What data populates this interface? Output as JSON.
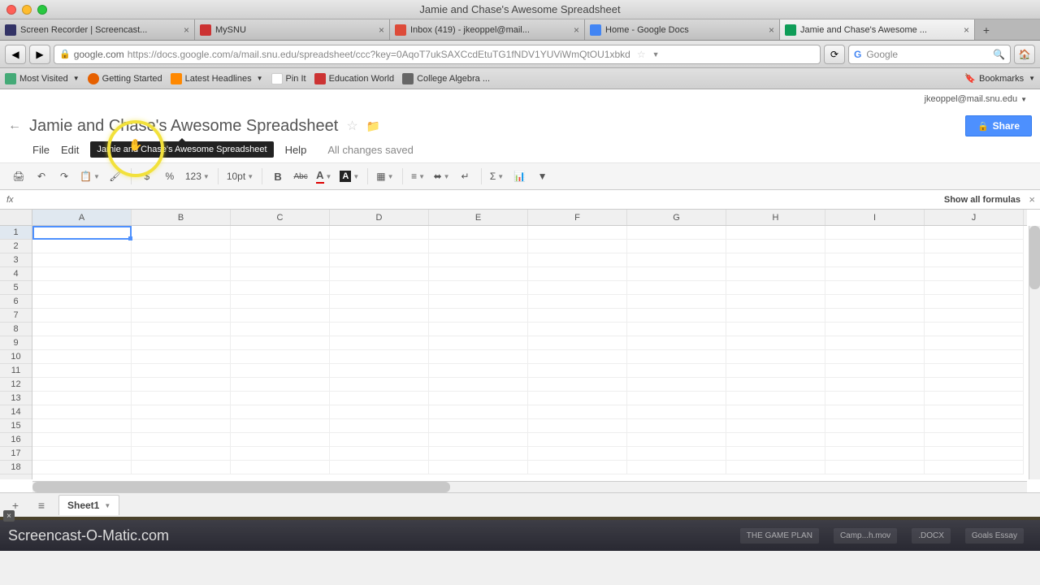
{
  "window": {
    "title": "Jamie and Chase's Awesome Spreadsheet"
  },
  "tabs": [
    {
      "label": "Screen Recorder | Screencast..."
    },
    {
      "label": "MySNU"
    },
    {
      "label": "Inbox (419) - jkeoppel@mail..."
    },
    {
      "label": "Home - Google Docs"
    },
    {
      "label": "Jamie and Chase's Awesome ..."
    }
  ],
  "url": {
    "domain": "google.com",
    "path": "https://docs.google.com/a/mail.snu.edu/spreadsheet/ccc?key=0AqoT7ukSAXCcdEtuTG1fNDV1YUViWmQtOU1xbkd"
  },
  "search": {
    "placeholder": "Google"
  },
  "bookmarks": [
    {
      "label": "Most Visited"
    },
    {
      "label": "Getting Started"
    },
    {
      "label": "Latest Headlines"
    },
    {
      "label": "Pin It"
    },
    {
      "label": "Education World"
    },
    {
      "label": "College Algebra ..."
    }
  ],
  "bookmarks_menu": "Bookmarks",
  "user_email": "jkeoppel@mail.snu.edu",
  "doc": {
    "title": "Jamie and Chase's Awesome Spreadsheet",
    "tooltip": "Jamie and Chase's Awesome Spreadsheet",
    "save_state": "All changes saved",
    "share": "Share"
  },
  "menu": {
    "file": "File",
    "edit": "Edit",
    "help": "Help"
  },
  "toolbar": {
    "dollar": "$",
    "percent": "%",
    "num123": "123",
    "fontsize": "10pt",
    "bold": "B",
    "strike": "Abc"
  },
  "formula_bar": {
    "fx": "fx",
    "show_all": "Show all formulas"
  },
  "columns": [
    "A",
    "B",
    "C",
    "D",
    "E",
    "F",
    "G",
    "H",
    "I",
    "J"
  ],
  "rows": [
    "1",
    "2",
    "3",
    "4",
    "5",
    "6",
    "7",
    "8",
    "9",
    "10",
    "11",
    "12",
    "13",
    "14",
    "15",
    "16",
    "17",
    "18"
  ],
  "sheet_tab": "Sheet1",
  "watermark": {
    "text": "Screencast-O-Matic.com",
    "cards": [
      "THE GAME PLAN",
      "Camp...h.mov",
      ".DOCX",
      "Goals Essay"
    ]
  }
}
